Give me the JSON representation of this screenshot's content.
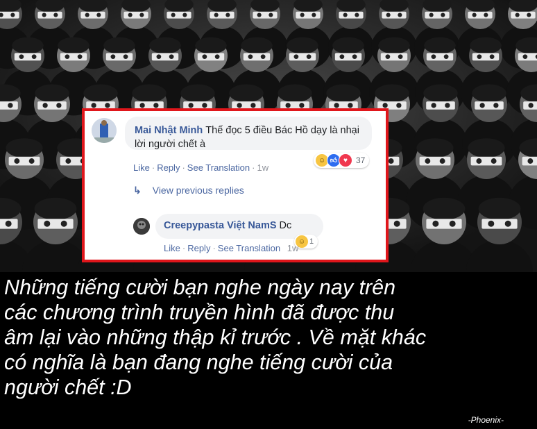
{
  "comment1": {
    "author": "Mai Nhật Minh",
    "text": "Thế đọc 5 điều Bác Hồ dạy là nhại lời người chết à",
    "reaction_count": "37",
    "actions": {
      "like": "Like",
      "reply": "Reply",
      "translate": "See Translation",
      "time": "1w"
    }
  },
  "view_previous": "View previous replies",
  "comment2": {
    "author": "Creepypasta Việt NamS",
    "text": "Dc",
    "reaction_count": "1",
    "actions": {
      "like": "Like",
      "reply": "Reply",
      "translate": "See Translation",
      "time": "1w"
    }
  },
  "caption_lines": [
    "Những tiếng cười bạn nghe ngày nay trên",
    "các chương trình truyền hình đã được thu",
    "âm lại vào những thập kỉ trước . Về mặt khác",
    "có nghĩa là bạn đang nghe tiếng cười của",
    "người chết :D"
  ],
  "signature": "-Phoenix-",
  "colors": {
    "border": "#e0161b",
    "link": "#4b67a1",
    "author": "#385898"
  }
}
